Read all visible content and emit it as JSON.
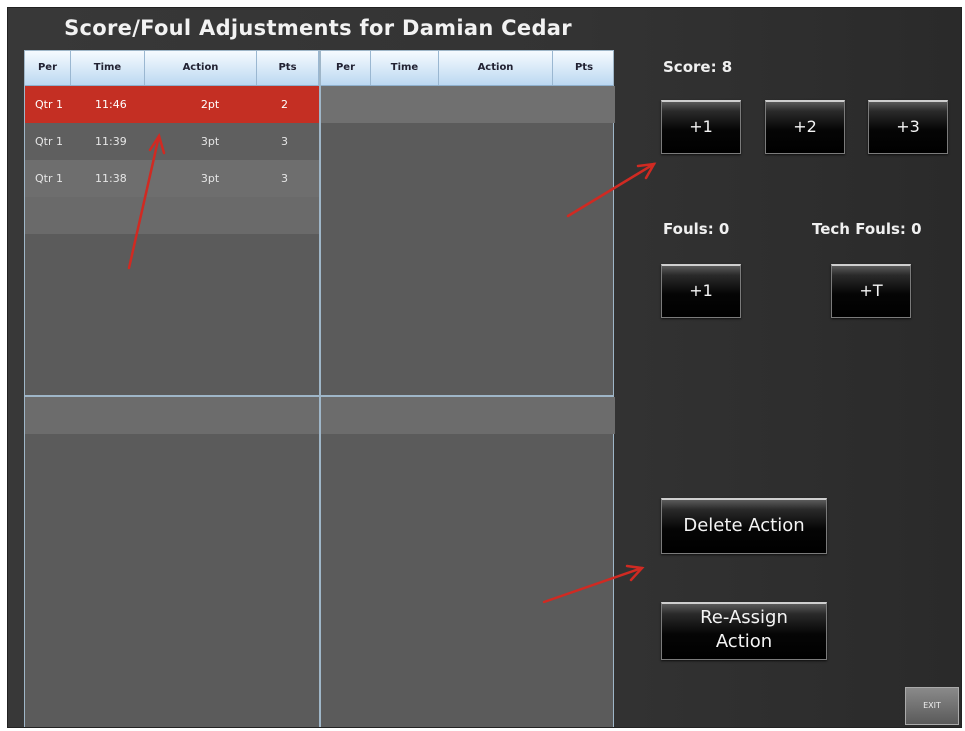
{
  "title": "Score/Foul Adjustments for Damian Cedar",
  "columns": [
    "Per",
    "Time",
    "Action",
    "Pts",
    "Per",
    "Time",
    "Action",
    "Pts"
  ],
  "rows": [
    {
      "per": "Qtr 1",
      "time": "11:46",
      "action": "2pt",
      "pts": "2",
      "selected": true
    },
    {
      "per": "Qtr 1",
      "time": "11:39",
      "action": "3pt",
      "pts": "3"
    },
    {
      "per": "Qtr 1",
      "time": "11:38",
      "action": "3pt",
      "pts": "3"
    }
  ],
  "score": {
    "label": "Score: 8",
    "buttons": [
      "+1",
      "+2",
      "+3"
    ]
  },
  "fouls": {
    "label": "Fouls: 0",
    "button": "+1"
  },
  "tech_fouls": {
    "label": "Tech Fouls: 0",
    "button": "+T"
  },
  "actions": {
    "delete": "Delete Action",
    "reassign_line1": "Re-Assign",
    "reassign_line2": "Action"
  },
  "exit": "EXIT",
  "colors": {
    "selected_row": "#c42f23",
    "header": "#cfe3f6",
    "arrow": "#d02a22"
  }
}
